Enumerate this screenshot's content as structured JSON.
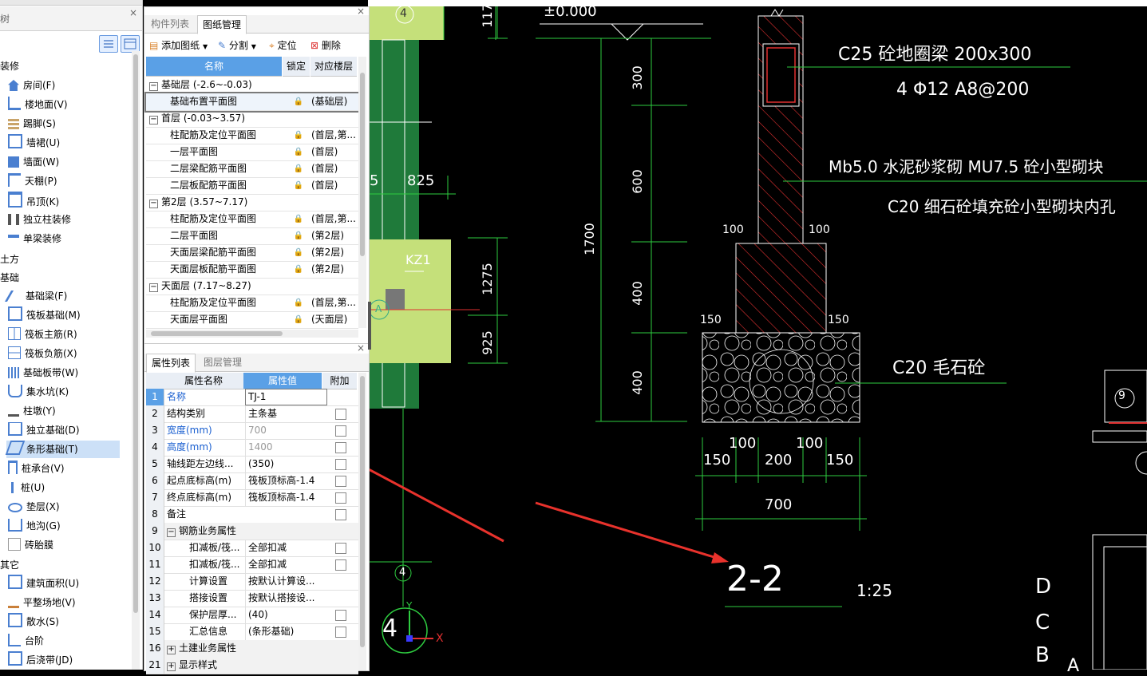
{
  "tree": {
    "header": "树",
    "categories": [
      "装修",
      "土方",
      "基础",
      "其它"
    ],
    "items_zhuangxiu": [
      "房间(F)",
      "楼地面(V)",
      "踢脚(S)",
      "墙裙(U)",
      "墙面(W)",
      "天棚(P)",
      "吊顶(K)",
      "独立柱装修",
      "单梁装修"
    ],
    "items_jichu": [
      "基础梁(F)",
      "筏板基础(M)",
      "筏板主筋(R)",
      "筏板负筋(X)",
      "基础板带(W)",
      "集水坑(K)",
      "柱墩(Y)",
      "独立基础(D)",
      "条形基础(T)",
      "桩承台(V)",
      "桩(U)",
      "垫层(X)",
      "地沟(G)",
      "砖胎膜"
    ],
    "items_qita": [
      "建筑面积(U)",
      "平整场地(V)",
      "散水(S)",
      "台阶",
      "后浇带(JD)"
    ]
  },
  "drawing_panel": {
    "tab_inactive": "构件列表",
    "tab_active": "图纸管理",
    "toolbar": {
      "add": "添加图纸",
      "split": "分割",
      "locate": "定位",
      "delete": "删除"
    },
    "columns": {
      "name": "名称",
      "lock": "锁定",
      "floor": "对应楼层"
    },
    "rows": [
      {
        "type": "group",
        "name": "基础层 (-2.6~-0.03)"
      },
      {
        "type": "item",
        "name": "基础布置平面图",
        "floor": "(基础层)"
      },
      {
        "type": "group",
        "name": "首层 (-0.03~3.57)"
      },
      {
        "type": "item",
        "name": "柱配筋及定位平面图",
        "floor": "(首层,第..."
      },
      {
        "type": "item",
        "name": "一层平面图",
        "floor": "(首层)"
      },
      {
        "type": "item",
        "name": "二层梁配筋平面图",
        "floor": "(首层)"
      },
      {
        "type": "item",
        "name": "二层板配筋平面图",
        "floor": "(首层)"
      },
      {
        "type": "group",
        "name": "第2层 (3.57~7.17)"
      },
      {
        "type": "item",
        "name": "柱配筋及定位平面图",
        "floor": "(首层,第..."
      },
      {
        "type": "item",
        "name": "二层平面图",
        "floor": "(第2层)"
      },
      {
        "type": "item",
        "name": "天面层梁配筋平面图",
        "floor": "(第2层)"
      },
      {
        "type": "item",
        "name": "天面层板配筋平面图",
        "floor": "(第2层)"
      },
      {
        "type": "group",
        "name": "天面层 (7.17~8.27)"
      },
      {
        "type": "item",
        "name": "柱配筋及定位平面图",
        "floor": "(首层,第..."
      },
      {
        "type": "item",
        "name": "天面层平面图",
        "floor": "(天面层)"
      }
    ]
  },
  "prop_panel": {
    "tab_active": "属性列表",
    "tab_inactive": "图层管理",
    "columns": {
      "name": "属性名称",
      "value": "属性值",
      "extra": "附加"
    },
    "rows": [
      {
        "num": "1",
        "name": "名称",
        "value": "TJ-1",
        "color": "blue",
        "chk": false
      },
      {
        "num": "2",
        "name": "结构类别",
        "value": "主条基",
        "color": "",
        "chk": true
      },
      {
        "num": "3",
        "name": "宽度(mm)",
        "value": "700",
        "color": "blue",
        "chk": true,
        "grey": true
      },
      {
        "num": "4",
        "name": "高度(mm)",
        "value": "1400",
        "color": "blue",
        "chk": true,
        "grey": true
      },
      {
        "num": "5",
        "name": "轴线距左边线...",
        "value": "(350)",
        "color": "",
        "chk": true
      },
      {
        "num": "6",
        "name": "起点底标高(m)",
        "value": "筏板顶标高-1.4",
        "color": "",
        "chk": true
      },
      {
        "num": "7",
        "name": "终点底标高(m)",
        "value": "筏板顶标高-1.4",
        "color": "",
        "chk": true
      },
      {
        "num": "8",
        "name": "备注",
        "value": "",
        "color": "",
        "chk": true
      },
      {
        "num": "9",
        "name": "钢筋业务属性",
        "value": "",
        "color": "",
        "chk": false,
        "group": true
      },
      {
        "num": "10",
        "name": "扣减板/筏...",
        "value": "全部扣减",
        "color": "",
        "chk": true,
        "indent": true
      },
      {
        "num": "11",
        "name": "扣减板/筏...",
        "value": "全部扣减",
        "color": "",
        "chk": true,
        "indent": true
      },
      {
        "num": "12",
        "name": "计算设置",
        "value": "按默认计算设...",
        "color": "",
        "chk": false,
        "indent": true
      },
      {
        "num": "13",
        "name": "搭接设置",
        "value": "按默认搭接设...",
        "color": "",
        "chk": false,
        "indent": true
      },
      {
        "num": "14",
        "name": "保护层厚...",
        "value": "(40)",
        "color": "",
        "chk": true,
        "indent": true
      },
      {
        "num": "15",
        "name": "汇总信息",
        "value": "(条形基础)",
        "color": "",
        "chk": true,
        "indent": true
      },
      {
        "num": "16",
        "name": "土建业务属性",
        "value": "",
        "color": "",
        "chk": false,
        "plus": true
      },
      {
        "num": "21",
        "name": "显示样式",
        "value": "",
        "color": "",
        "chk": false,
        "plus": true
      }
    ]
  },
  "cad": {
    "elev": "±0.000",
    "beam_line1": "C25   砼地圈梁      200x300",
    "beam_line2": "4  Φ12    A8@200",
    "wall_line1": "Mb5.0   水泥砂浆砌   MU7.5   砼小型砌块",
    "wall_line2": "C20   细石砼填充砼小型砌块内孔",
    "rubble": "C20   毛石砼",
    "section": "2-2",
    "scale": "1:25",
    "dims_v": [
      "300",
      "600",
      "400",
      "400",
      "1700"
    ],
    "dims_left": [
      "1275",
      "925"
    ],
    "dim_top": "117",
    "d100a": "100",
    "d100b": "100",
    "d150a": "150",
    "d150b": "150",
    "bottom_dims": [
      "150",
      "100",
      "200",
      "100",
      "150"
    ],
    "total": "700",
    "col_label": "KZ1",
    "dim825": "825",
    "dim5": "5",
    "axis_a": "A",
    "axis4": "4",
    "axis4_bottom": "4",
    "circle9": "9",
    "letters": [
      "D",
      "C",
      "B",
      "A"
    ],
    "big4": "4",
    "x_axis": "X",
    "y_axis": "Y"
  }
}
